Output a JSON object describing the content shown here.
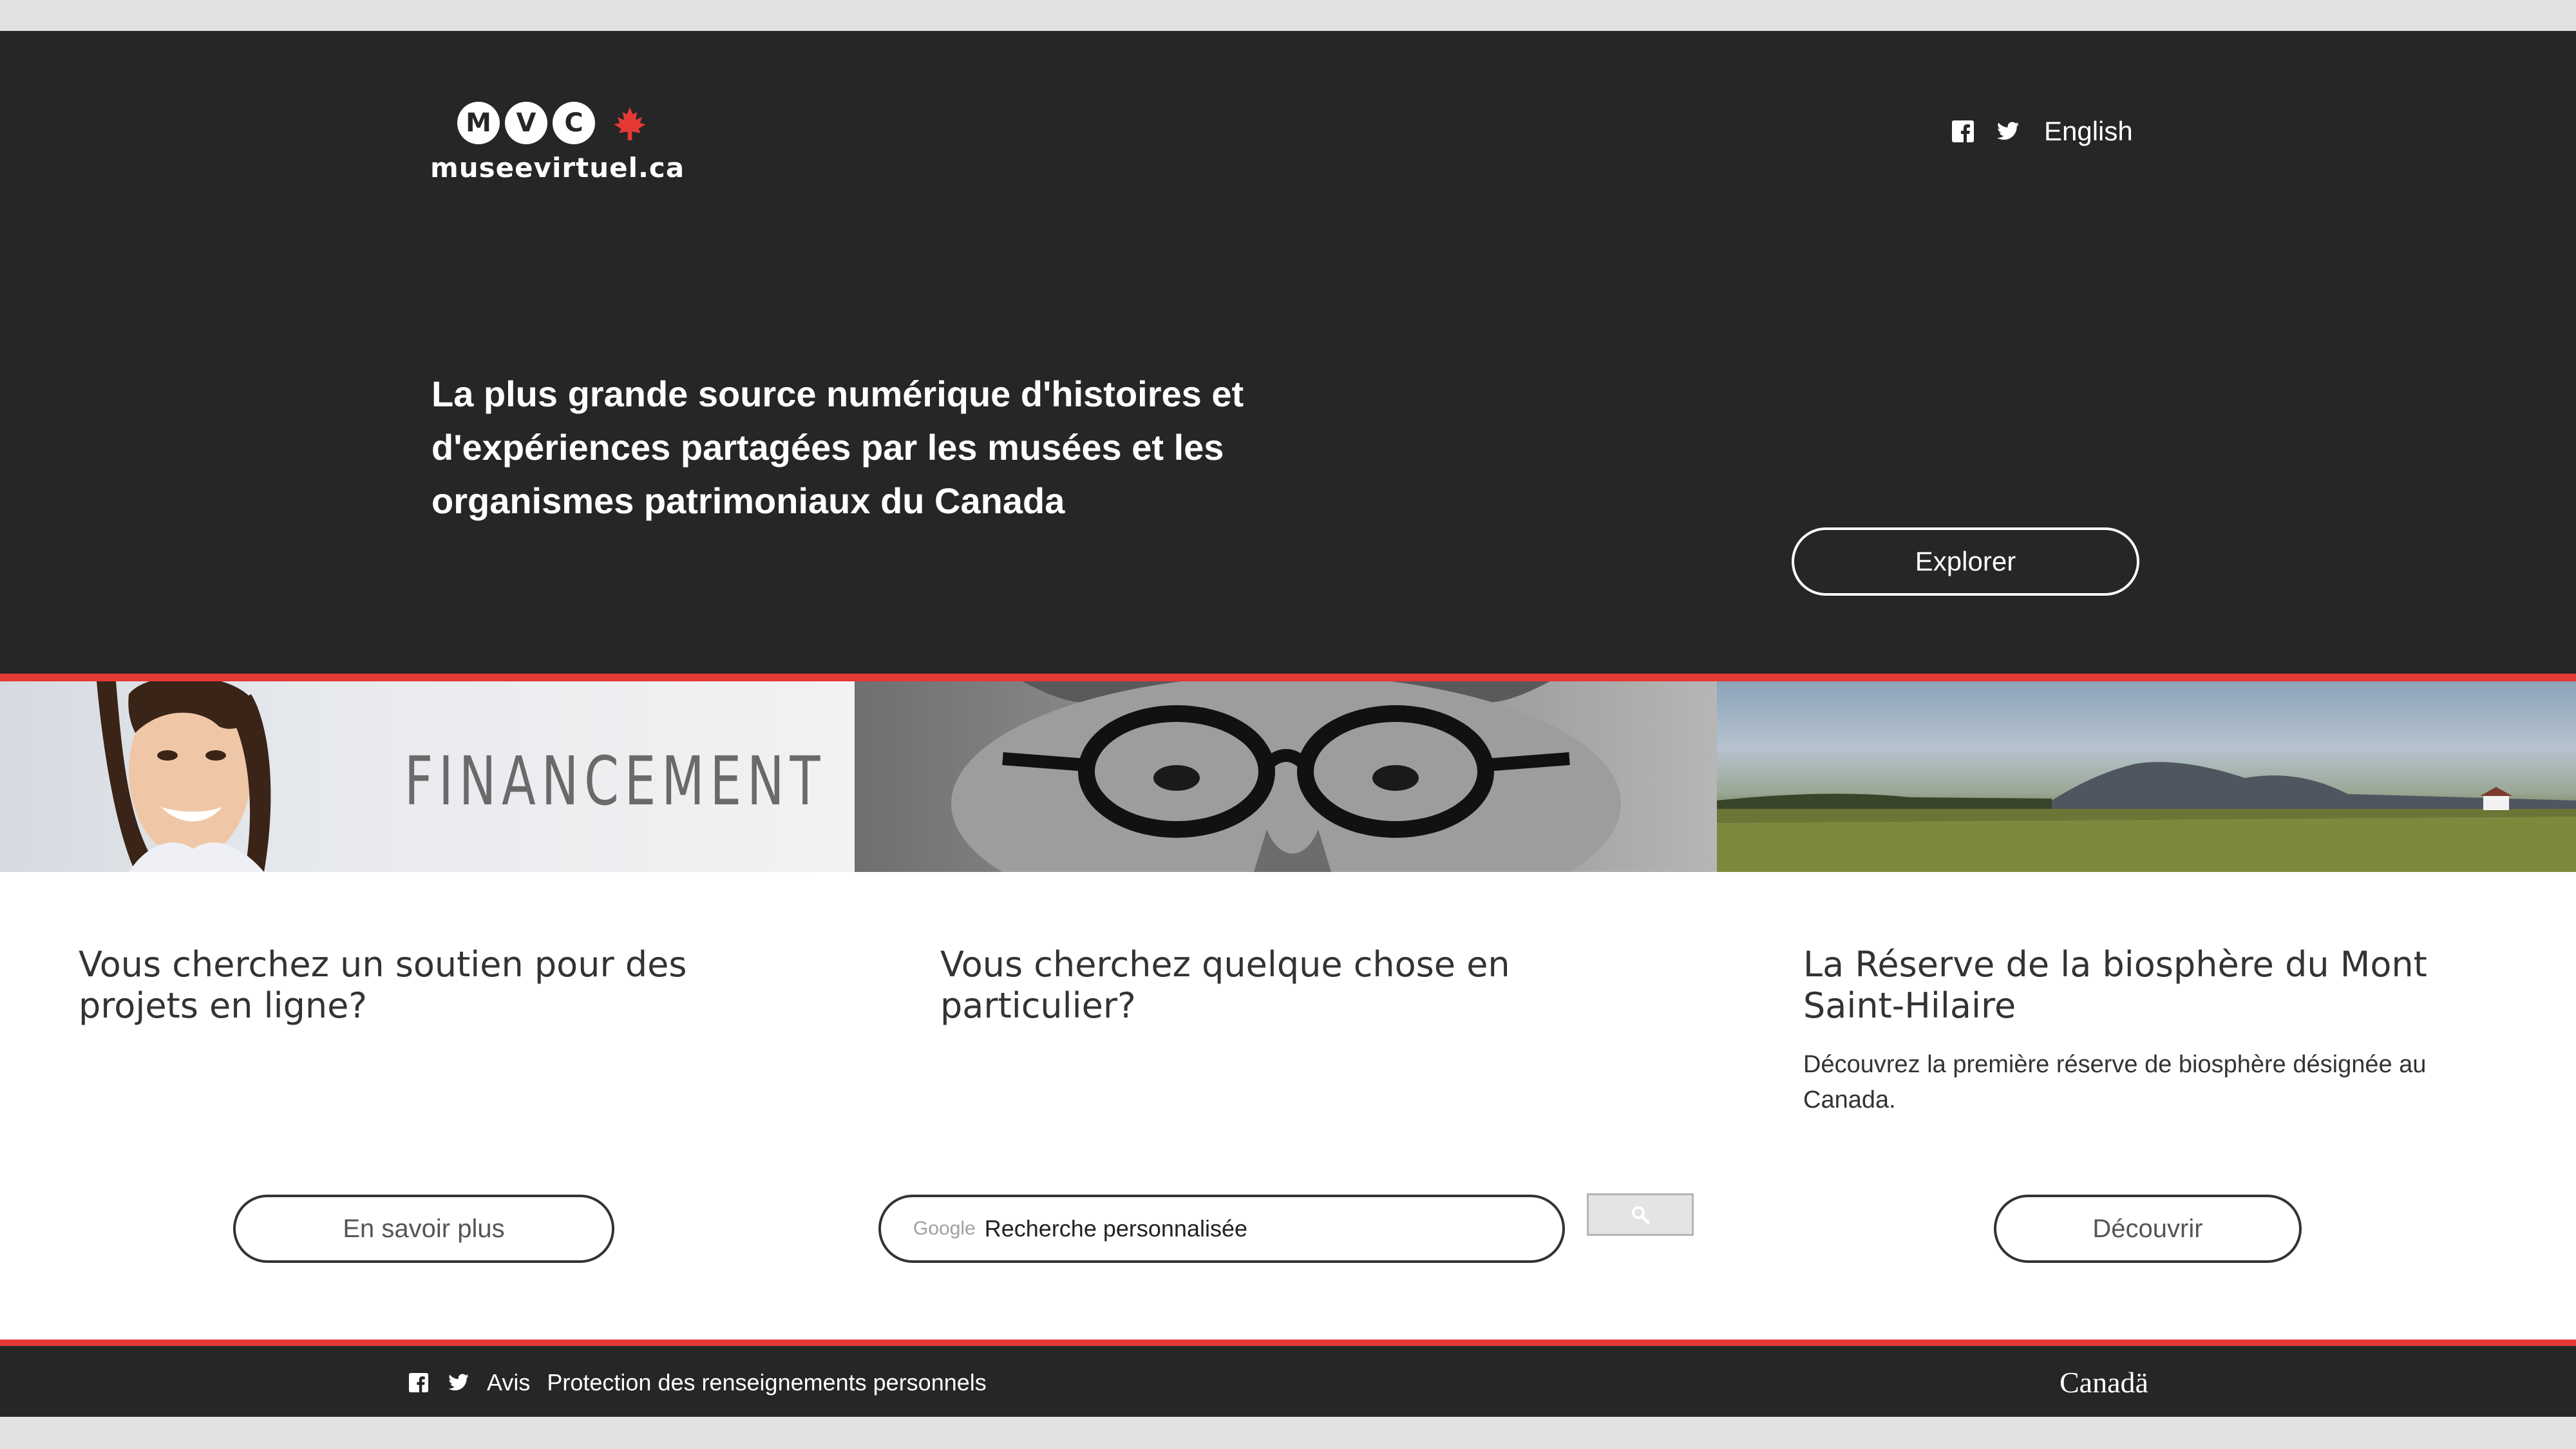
{
  "header": {
    "logo_letters": [
      "M",
      "V",
      "C"
    ],
    "logo_word": "museevirtuel.ca",
    "language_label": "English"
  },
  "hero": {
    "text": "La plus grande source numérique d'histoires et d'expériences partagées par les musées et les organismes patrimoniaux du Canada",
    "explore_label": "Explorer"
  },
  "cards": [
    {
      "image_text": "FINANCEMENT",
      "title": "Vous cherchez un soutien pour des projets en ligne?",
      "button_label": "En savoir plus"
    },
    {
      "title": "Vous cherchez quelque chose en particulier?",
      "search_brand": "Google",
      "search_placeholder": "Recherche personnalisée"
    },
    {
      "title": "La Réserve de la biosphère du Mont Saint-Hilaire",
      "description": "Découvrez la première réserve de biosphère désignée au Canada.",
      "button_label": "Découvrir"
    }
  ],
  "footer": {
    "links": [
      "Avis",
      "Protection des renseignements personnels"
    ],
    "wordmark": "Canadä"
  },
  "colors": {
    "dark": "#262626",
    "accent": "#e53935",
    "light": "#ffffff"
  },
  "icons": {
    "social": [
      "facebook-icon",
      "twitter-icon"
    ],
    "search": "search-icon",
    "logo_leaf": "maple-leaf-icon"
  }
}
